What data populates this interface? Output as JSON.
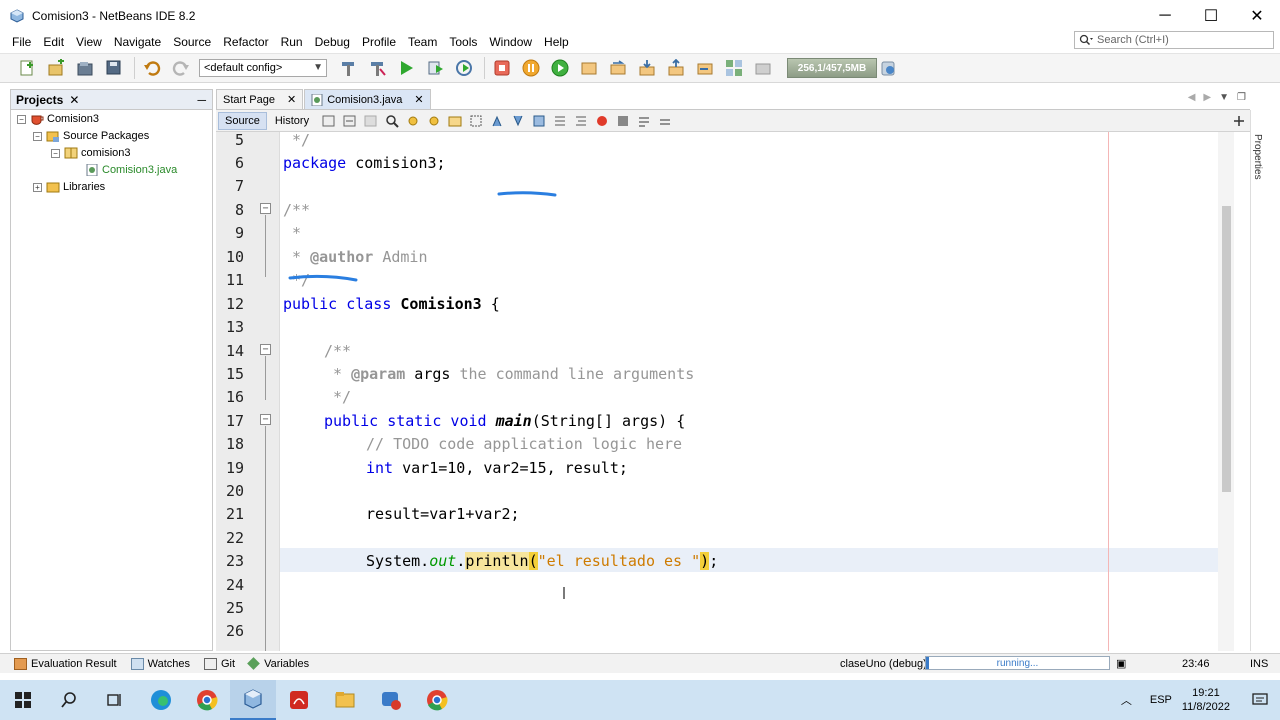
{
  "window": {
    "title": "Comision3 - NetBeans IDE 8.2",
    "minimize": "─",
    "maximize": "☐",
    "close": "✕"
  },
  "menu": [
    "File",
    "Edit",
    "View",
    "Navigate",
    "Source",
    "Refactor",
    "Run",
    "Debug",
    "Profile",
    "Team",
    "Tools",
    "Window",
    "Help"
  ],
  "search": {
    "placeholder": "Search (Ctrl+I)"
  },
  "toolbar": {
    "config": "<default config>",
    "memory": "256,1/457,5MB"
  },
  "projects": {
    "tab_label": "Projects",
    "tree": [
      {
        "label": "Comision3",
        "level": 0,
        "toggle": "−"
      },
      {
        "label": "Source Packages",
        "level": 1,
        "toggle": "−"
      },
      {
        "label": "comision3",
        "level": 2,
        "toggle": "−"
      },
      {
        "label": "Comision3.java",
        "level": 3,
        "toggle": ""
      },
      {
        "label": "Libraries",
        "level": 1,
        "toggle": "+"
      }
    ]
  },
  "editor": {
    "tabs": [
      {
        "label": "Start Page",
        "active": false
      },
      {
        "label": "Comision3.java",
        "active": true
      }
    ],
    "source_label": "Source",
    "history_label": "History",
    "line_numbers": [
      "5",
      "6",
      "7",
      "8",
      "9",
      "10",
      "11",
      "12",
      "13",
      "14",
      "15",
      "16",
      "17",
      "18",
      "19",
      "20",
      "21",
      "22",
      "23",
      "24",
      "25",
      "26"
    ],
    "code": {
      "l5": " */",
      "l6_kw": "package",
      "l6_rest": " comision3;",
      "l8": "/**",
      "l9": " *",
      "l10_pre": " * ",
      "l10_tag": "@author",
      "l10_rest": " Admin",
      "l11": " */",
      "l12_kw": "public class",
      "l12_name": "Comision3",
      "l12_rest": " {",
      "l14": "/**",
      "l15_pre": " * ",
      "l15_tag": "@param",
      "l15_arg": " args",
      "l15_rest": " the command line arguments",
      "l16": " */",
      "l17_kw": "public static void",
      "l17_name": "main",
      "l17_rest": "(String[] args) {",
      "l18": "// TODO code application logic here",
      "l19_kw": "int",
      "l19_rest": " var1=10, var2=15, result;",
      "l21": "result=var1+var2;",
      "l23_a": "System.",
      "l23_out": "out",
      "l23_dot": ".",
      "l23_m": "println",
      "l23_p": "(",
      "l23_str": "\"el resultado es \"",
      "l23_close": ")",
      "l23_end": ";"
    }
  },
  "rightpanel": {
    "label": "Properties"
  },
  "statusbar": {
    "items": [
      "Evaluation Result",
      "Watches",
      "Git",
      "Variables"
    ],
    "session": "claseUno (debug)",
    "progress": "running...",
    "position": "23:46",
    "mode": "INS"
  },
  "taskbar": {
    "lang": "ESP",
    "time": "19:21",
    "date": "11/8/2022"
  },
  "colors": {
    "accent": "#3a7bc8",
    "keyword": "#0000e6",
    "string": "#ce7b00",
    "comment": "#969696"
  }
}
